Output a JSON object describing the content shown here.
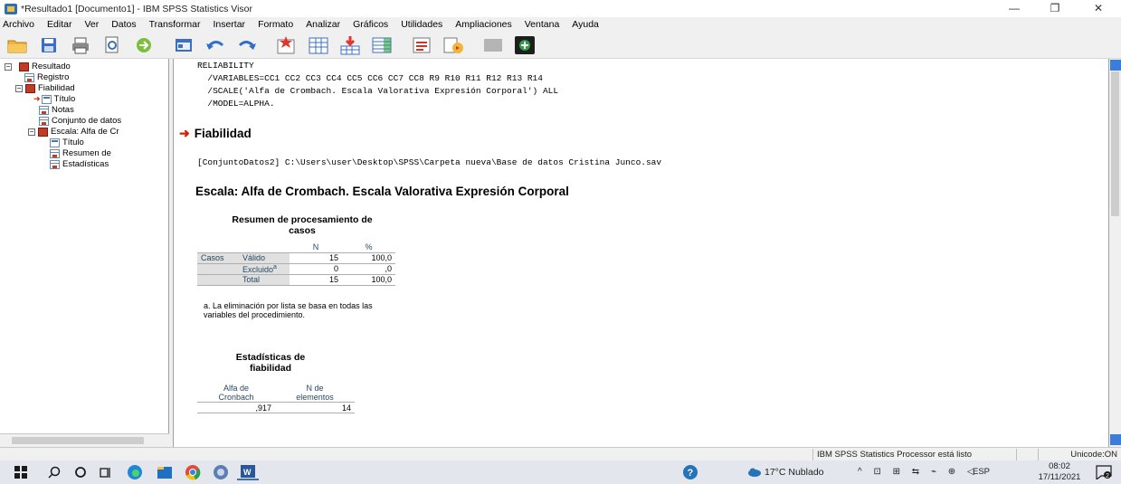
{
  "window": {
    "title": "*Resultado1 [Documento1] - IBM SPSS Statistics Visor",
    "minimize": "—",
    "restore": "❐",
    "close": "✕"
  },
  "menu": [
    "Archivo",
    "Editar",
    "Ver",
    "Datos",
    "Transformar",
    "Insertar",
    "Formato",
    "Analizar",
    "Gráficos",
    "Utilidades",
    "Ampliaciones",
    "Ventana",
    "Ayuda"
  ],
  "toolbar_icons": [
    "open-folder-icon",
    "save-icon",
    "print-icon",
    "print-preview-icon",
    "export-icon",
    "recall-dialog-icon",
    "undo-icon",
    "redo-icon",
    "goto-data-icon",
    "goto-case-icon",
    "insert-variable-icon",
    "insert-output-icon",
    "insert-heading-icon",
    "insert-title-icon",
    "disabled-icon",
    "add-icon"
  ],
  "outline": {
    "items": [
      {
        "label": "Resultado"
      },
      {
        "label": "Registro"
      },
      {
        "label": "Fiabilidad"
      },
      {
        "label": "Título"
      },
      {
        "label": "Notas"
      },
      {
        "label": "Conjunto de datos"
      },
      {
        "label": "Escala: Alfa de Cr"
      },
      {
        "label": "Título"
      },
      {
        "label": "Resumen de"
      },
      {
        "label": "Estadísticas"
      }
    ]
  },
  "content": {
    "syntax": "RELIABILITY\n  /VARIABLES=CC1 CC2 CC3 CC4 CC5 CC6 CC7 CC8 R9 R10 R11 R12 R13 R14\n  /SCALE('Alfa de Crombach. Escala Valorativa Expresión Corporal') ALL\n  /MODEL=ALPHA.",
    "section_title": "Fiabilidad",
    "dataset_path": "[ConjuntoDatos2] C:\\Users\\user\\Desktop\\SPSS\\Carpeta nueva\\Base de datos Cristina Junco.sav",
    "scale_title": "Escala: Alfa de Crombach. Escala Valorativa Expresión Corporal",
    "case_summary": {
      "title_line1": "Resumen de procesamiento de",
      "title_line2": "casos",
      "col_n": "N",
      "col_pct": "%",
      "group_label": "Casos",
      "rows": [
        {
          "label": "Válido",
          "n": "15",
          "pct": "100,0"
        },
        {
          "label": "Excluido",
          "sup": "a",
          "n": "0",
          "pct": ",0"
        },
        {
          "label": "Total",
          "n": "15",
          "pct": "100,0"
        }
      ],
      "footnote": "a. La eliminación por lista se basa en todas las variables del procedimiento."
    },
    "reliability": {
      "title_line1": "Estadísticas de",
      "title_line2": "fiabilidad",
      "col1_line1": "Alfa de",
      "col1_line2": "Cronbach",
      "col2_line1": "N de",
      "col2_line2": "elementos",
      "alpha": ",917",
      "n_items": "14"
    }
  },
  "status": {
    "processor": "IBM SPSS Statistics Processor está listo",
    "encoding": "Unicode:ON"
  },
  "taskbar": {
    "weather": "17°C  Nublado",
    "lang": "ESP",
    "time": "08:02",
    "date": "17/11/2021",
    "notifications": "2"
  }
}
